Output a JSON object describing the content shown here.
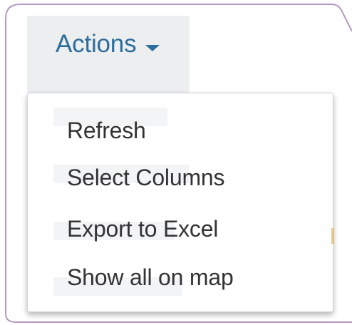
{
  "actions_button": {
    "label": "Actions",
    "caret_icon": "caret-down-icon"
  },
  "menu": {
    "items": [
      {
        "label": "Refresh"
      },
      {
        "label": "Select Columns"
      },
      {
        "label": "Export to Excel"
      },
      {
        "label": "Show all on map"
      }
    ]
  },
  "colors": {
    "link": "#2d6d9c",
    "button_bg": "#eceeef",
    "menu_text": "#333333",
    "frame": "#b49ac2"
  }
}
